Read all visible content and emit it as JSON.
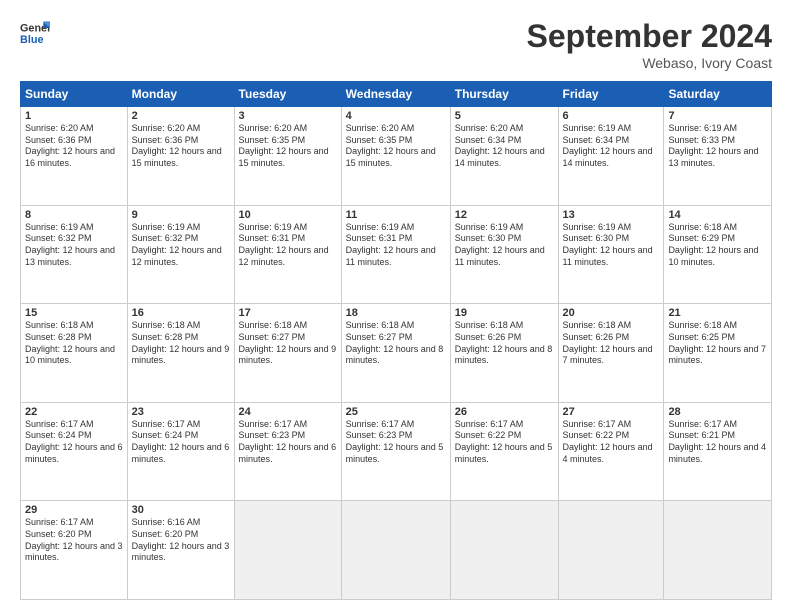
{
  "logo": {
    "line1": "General",
    "line2": "Blue"
  },
  "title": "September 2024",
  "location": "Webaso, Ivory Coast",
  "days": [
    "Sunday",
    "Monday",
    "Tuesday",
    "Wednesday",
    "Thursday",
    "Friday",
    "Saturday"
  ],
  "weeks": [
    [
      {
        "day": "1",
        "sunrise": "6:20 AM",
        "sunset": "6:36 PM",
        "daylight": "12 hours and 16 minutes."
      },
      {
        "day": "2",
        "sunrise": "6:20 AM",
        "sunset": "6:36 PM",
        "daylight": "12 hours and 15 minutes."
      },
      {
        "day": "3",
        "sunrise": "6:20 AM",
        "sunset": "6:35 PM",
        "daylight": "12 hours and 15 minutes."
      },
      {
        "day": "4",
        "sunrise": "6:20 AM",
        "sunset": "6:35 PM",
        "daylight": "12 hours and 15 minutes."
      },
      {
        "day": "5",
        "sunrise": "6:20 AM",
        "sunset": "6:34 PM",
        "daylight": "12 hours and 14 minutes."
      },
      {
        "day": "6",
        "sunrise": "6:19 AM",
        "sunset": "6:34 PM",
        "daylight": "12 hours and 14 minutes."
      },
      {
        "day": "7",
        "sunrise": "6:19 AM",
        "sunset": "6:33 PM",
        "daylight": "12 hours and 13 minutes."
      }
    ],
    [
      {
        "day": "8",
        "sunrise": "6:19 AM",
        "sunset": "6:32 PM",
        "daylight": "12 hours and 13 minutes."
      },
      {
        "day": "9",
        "sunrise": "6:19 AM",
        "sunset": "6:32 PM",
        "daylight": "12 hours and 12 minutes."
      },
      {
        "day": "10",
        "sunrise": "6:19 AM",
        "sunset": "6:31 PM",
        "daylight": "12 hours and 12 minutes."
      },
      {
        "day": "11",
        "sunrise": "6:19 AM",
        "sunset": "6:31 PM",
        "daylight": "12 hours and 11 minutes."
      },
      {
        "day": "12",
        "sunrise": "6:19 AM",
        "sunset": "6:30 PM",
        "daylight": "12 hours and 11 minutes."
      },
      {
        "day": "13",
        "sunrise": "6:19 AM",
        "sunset": "6:30 PM",
        "daylight": "12 hours and 11 minutes."
      },
      {
        "day": "14",
        "sunrise": "6:18 AM",
        "sunset": "6:29 PM",
        "daylight": "12 hours and 10 minutes."
      }
    ],
    [
      {
        "day": "15",
        "sunrise": "6:18 AM",
        "sunset": "6:28 PM",
        "daylight": "12 hours and 10 minutes."
      },
      {
        "day": "16",
        "sunrise": "6:18 AM",
        "sunset": "6:28 PM",
        "daylight": "12 hours and 9 minutes."
      },
      {
        "day": "17",
        "sunrise": "6:18 AM",
        "sunset": "6:27 PM",
        "daylight": "12 hours and 9 minutes."
      },
      {
        "day": "18",
        "sunrise": "6:18 AM",
        "sunset": "6:27 PM",
        "daylight": "12 hours and 8 minutes."
      },
      {
        "day": "19",
        "sunrise": "6:18 AM",
        "sunset": "6:26 PM",
        "daylight": "12 hours and 8 minutes."
      },
      {
        "day": "20",
        "sunrise": "6:18 AM",
        "sunset": "6:26 PM",
        "daylight": "12 hours and 7 minutes."
      },
      {
        "day": "21",
        "sunrise": "6:18 AM",
        "sunset": "6:25 PM",
        "daylight": "12 hours and 7 minutes."
      }
    ],
    [
      {
        "day": "22",
        "sunrise": "6:17 AM",
        "sunset": "6:24 PM",
        "daylight": "12 hours and 6 minutes."
      },
      {
        "day": "23",
        "sunrise": "6:17 AM",
        "sunset": "6:24 PM",
        "daylight": "12 hours and 6 minutes."
      },
      {
        "day": "24",
        "sunrise": "6:17 AM",
        "sunset": "6:23 PM",
        "daylight": "12 hours and 6 minutes."
      },
      {
        "day": "25",
        "sunrise": "6:17 AM",
        "sunset": "6:23 PM",
        "daylight": "12 hours and 5 minutes."
      },
      {
        "day": "26",
        "sunrise": "6:17 AM",
        "sunset": "6:22 PM",
        "daylight": "12 hours and 5 minutes."
      },
      {
        "day": "27",
        "sunrise": "6:17 AM",
        "sunset": "6:22 PM",
        "daylight": "12 hours and 4 minutes."
      },
      {
        "day": "28",
        "sunrise": "6:17 AM",
        "sunset": "6:21 PM",
        "daylight": "12 hours and 4 minutes."
      }
    ],
    [
      {
        "day": "29",
        "sunrise": "6:17 AM",
        "sunset": "6:20 PM",
        "daylight": "12 hours and 3 minutes."
      },
      {
        "day": "30",
        "sunrise": "6:16 AM",
        "sunset": "6:20 PM",
        "daylight": "12 hours and 3 minutes."
      },
      null,
      null,
      null,
      null,
      null
    ]
  ]
}
